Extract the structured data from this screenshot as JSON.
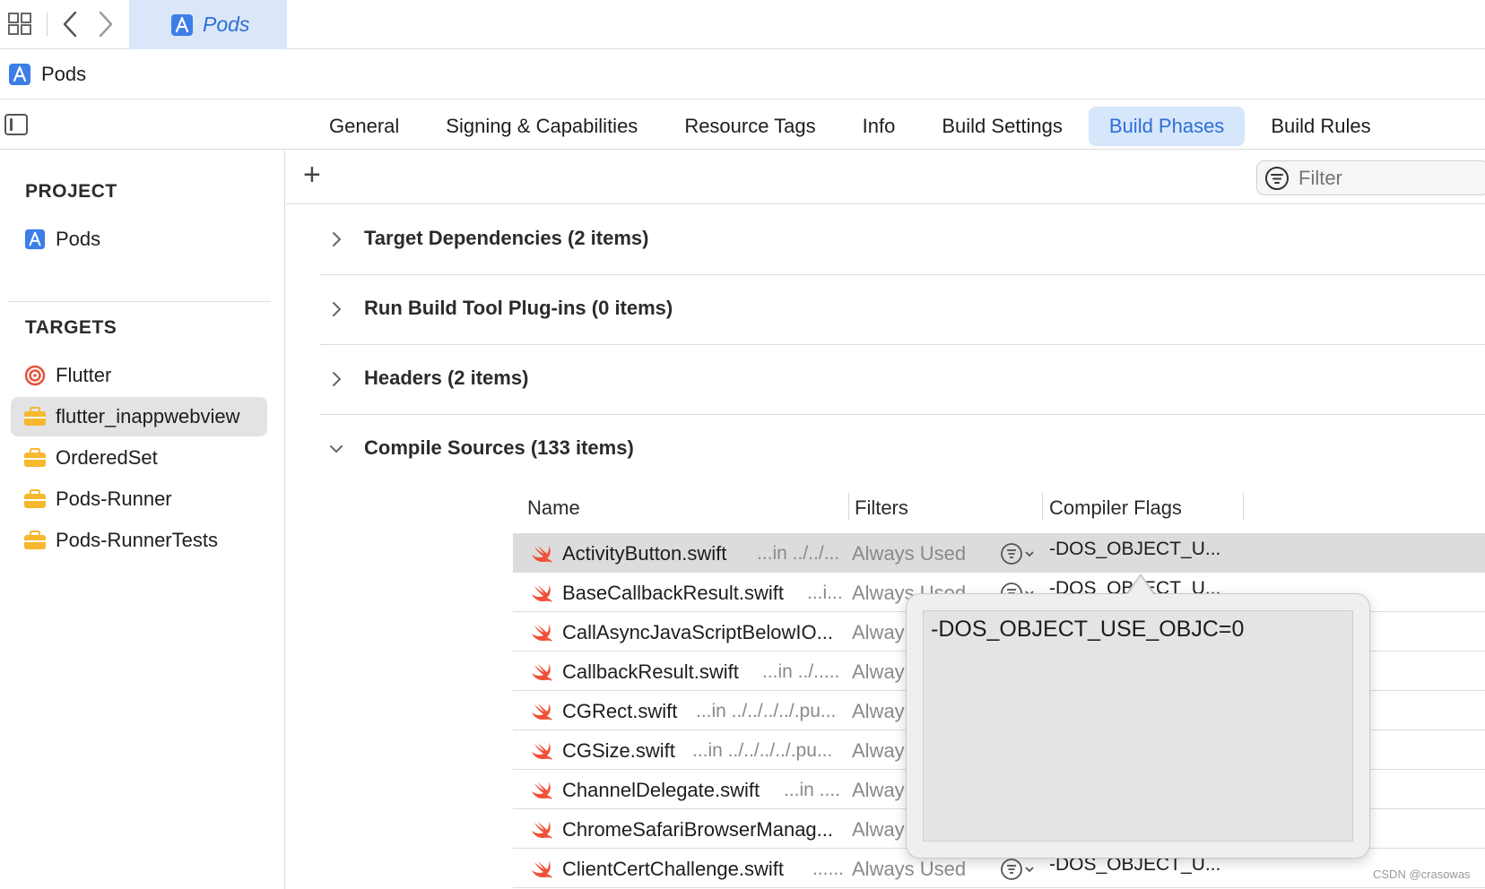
{
  "window": {
    "file_tab": "Pods"
  },
  "breadcrumb": {
    "project": "Pods"
  },
  "editor_tabs": [
    {
      "label": "General",
      "active": false
    },
    {
      "label": "Signing & Capabilities",
      "active": false
    },
    {
      "label": "Resource Tags",
      "active": false
    },
    {
      "label": "Info",
      "active": false
    },
    {
      "label": "Build Settings",
      "active": false
    },
    {
      "label": "Build Phases",
      "active": true
    },
    {
      "label": "Build Rules",
      "active": false
    }
  ],
  "sidebar": {
    "project_header": "PROJECT",
    "project_item": "Pods",
    "targets_header": "TARGETS",
    "targets": [
      {
        "label": "Flutter",
        "icon": "target-icon",
        "selected": false
      },
      {
        "label": "flutter_inappwebview",
        "icon": "toolbox-icon",
        "selected": true
      },
      {
        "label": "OrderedSet",
        "icon": "toolbox-icon",
        "selected": false
      },
      {
        "label": "Pods-Runner",
        "icon": "toolbox-icon",
        "selected": false
      },
      {
        "label": "Pods-RunnerTests",
        "icon": "toolbox-icon",
        "selected": false
      }
    ]
  },
  "toolbar": {
    "add": "+",
    "filter_placeholder": "Filter"
  },
  "phases": [
    {
      "title": "Target Dependencies (2 items)",
      "expanded": false
    },
    {
      "title": "Run Build Tool Plug-ins (0 items)",
      "expanded": false
    },
    {
      "title": "Headers (2 items)",
      "expanded": false
    },
    {
      "title": "Compile Sources (133 items)",
      "expanded": true
    }
  ],
  "table": {
    "columns": [
      "Name",
      "Filters",
      "Compiler Flags"
    ],
    "rows": [
      {
        "name": "ActivityButton.swift",
        "path": "...in ../../...",
        "filter": "Always Used",
        "flags": "-DOS_OBJECT_U...",
        "selected": true
      },
      {
        "name": "BaseCallbackResult.swift",
        "path": "...i...",
        "filter": "Always Used",
        "flags": "-DOS_OBJECT_U...",
        "selected": false
      },
      {
        "name": "CallAsyncJavaScriptBelowIO...",
        "path": "",
        "filter": "Alway",
        "flags": "",
        "selected": false
      },
      {
        "name": "CallbackResult.swift",
        "path": "...in ../.....",
        "filter": "Alway",
        "flags": "",
        "selected": false
      },
      {
        "name": "CGRect.swift",
        "path": "...in ../../../../.pu...",
        "filter": "Alway",
        "flags": "",
        "selected": false
      },
      {
        "name": "CGSize.swift",
        "path": "...in ../../../../.pu...",
        "filter": "Alway",
        "flags": "",
        "selected": false
      },
      {
        "name": "ChannelDelegate.swift",
        "path": "...in ....",
        "filter": "Alway",
        "flags": "",
        "selected": false
      },
      {
        "name": "ChromeSafariBrowserManag...",
        "path": "",
        "filter": "Alway",
        "flags": "",
        "selected": false
      },
      {
        "name": "ClientCertChallenge.swift",
        "path": "......",
        "filter": "Always Used",
        "flags": "-DOS_OBJECT_U...",
        "selected": false
      }
    ]
  },
  "popover": {
    "value": "-DOS_OBJECT_USE_OBJC=0"
  },
  "watermark": "CSDN @crasowas",
  "colors": {
    "accent": "#2e6fd6",
    "tab_highlight": "#d6e6fb",
    "swift": "#f05138",
    "toolbox": "#f5b82e",
    "target": "#e5533d"
  }
}
